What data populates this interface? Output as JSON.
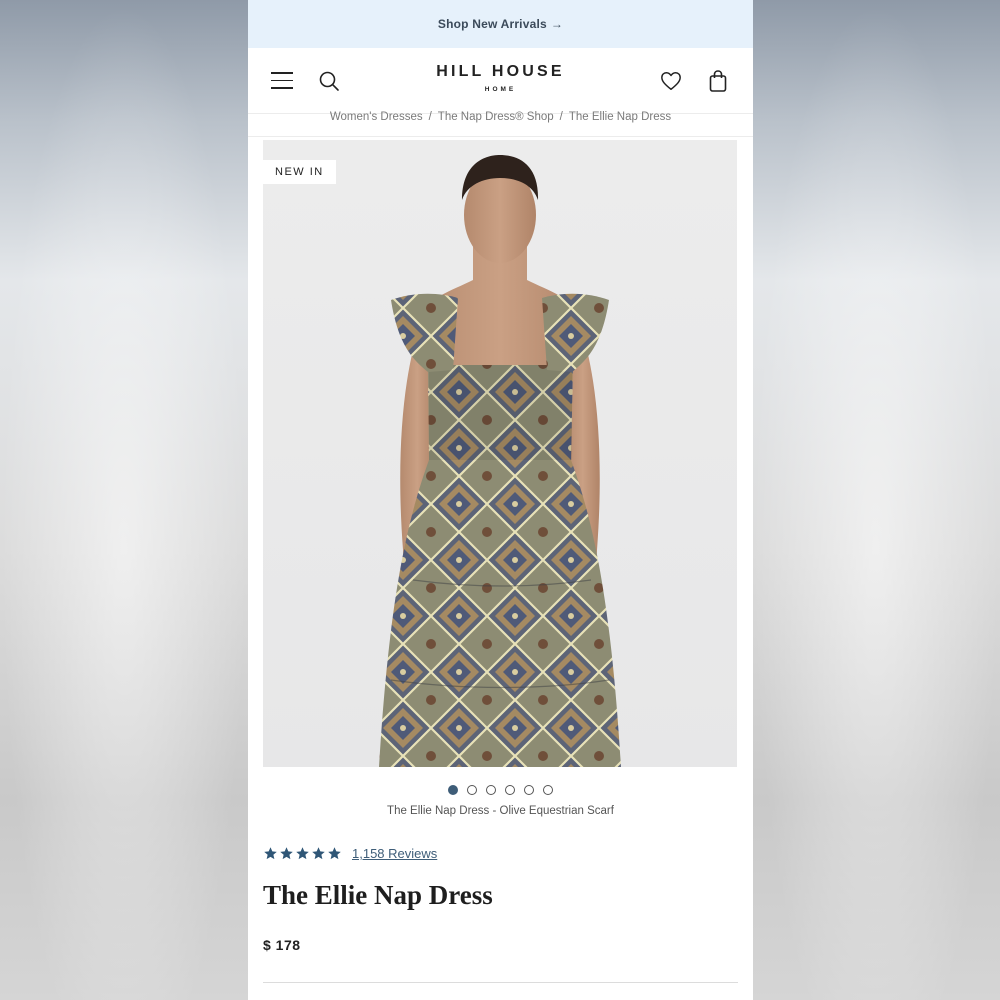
{
  "promo": {
    "label": "Shop New Arrivals",
    "arrow": "→"
  },
  "header": {
    "logo": "HILL HOUSE",
    "logo_sub": "HOME"
  },
  "breadcrumb": [
    "Women's Dresses",
    "The Nap Dress® Shop",
    "The Ellie Nap Dress"
  ],
  "breadcrumb_sep": "/",
  "gallery": {
    "badge": "NEW IN",
    "image_count": 6,
    "active_index": 0,
    "caption": "The Ellie Nap Dress - Olive Equestrian Scarf"
  },
  "product": {
    "rating": 5,
    "reviews_label": "1,158 Reviews",
    "title": "The Ellie Nap Dress",
    "price": "$ 178"
  },
  "colors": {
    "promo_bg": "#e6f1fb",
    "accent": "#3e5d78",
    "star": "#2f5676"
  }
}
